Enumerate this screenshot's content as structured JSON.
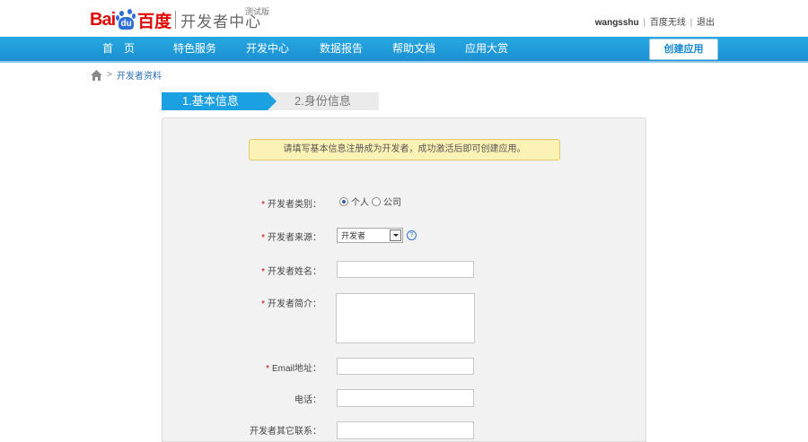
{
  "header": {
    "logo_bai": "Bai",
    "logo_du": "du",
    "logo_cn": "百度",
    "product": "开发者中心",
    "beta": "测试版",
    "username": "wangsshu",
    "user_link": "百度无线",
    "separator": "|",
    "logout": "退出"
  },
  "nav": {
    "items": [
      "首　页",
      "特色服务",
      "开发中心",
      "数据报告",
      "帮助文档",
      "应用大赏"
    ],
    "create_app": "创建应用"
  },
  "breadcrumb": {
    "arrow": ">",
    "current": "开发者资料"
  },
  "steps": [
    {
      "label": "1.基本信息",
      "active": true
    },
    {
      "label": "2.身份信息",
      "active": false
    }
  ],
  "notice": "请填写基本信息注册成为开发者，成功激活后即可创建应用。",
  "form": {
    "type_label": "开发者类别：",
    "type_options": [
      "个人",
      "公司"
    ],
    "type_selected": "个人",
    "source_label": "开发者来源：",
    "source_value": "开发者",
    "name_label": "开发者姓名：",
    "intro_label": "开发者简介：",
    "email_label": "Email地址：",
    "phone_label": "电话：",
    "other_label": "开发者其它联系："
  },
  "colors": {
    "nav_blue": "#1c8fd0",
    "step_active": "#1ba0e1",
    "brand_red": "#e10602",
    "brand_blue": "#2f6ed6",
    "notice_bg": "#fdf2b5"
  }
}
